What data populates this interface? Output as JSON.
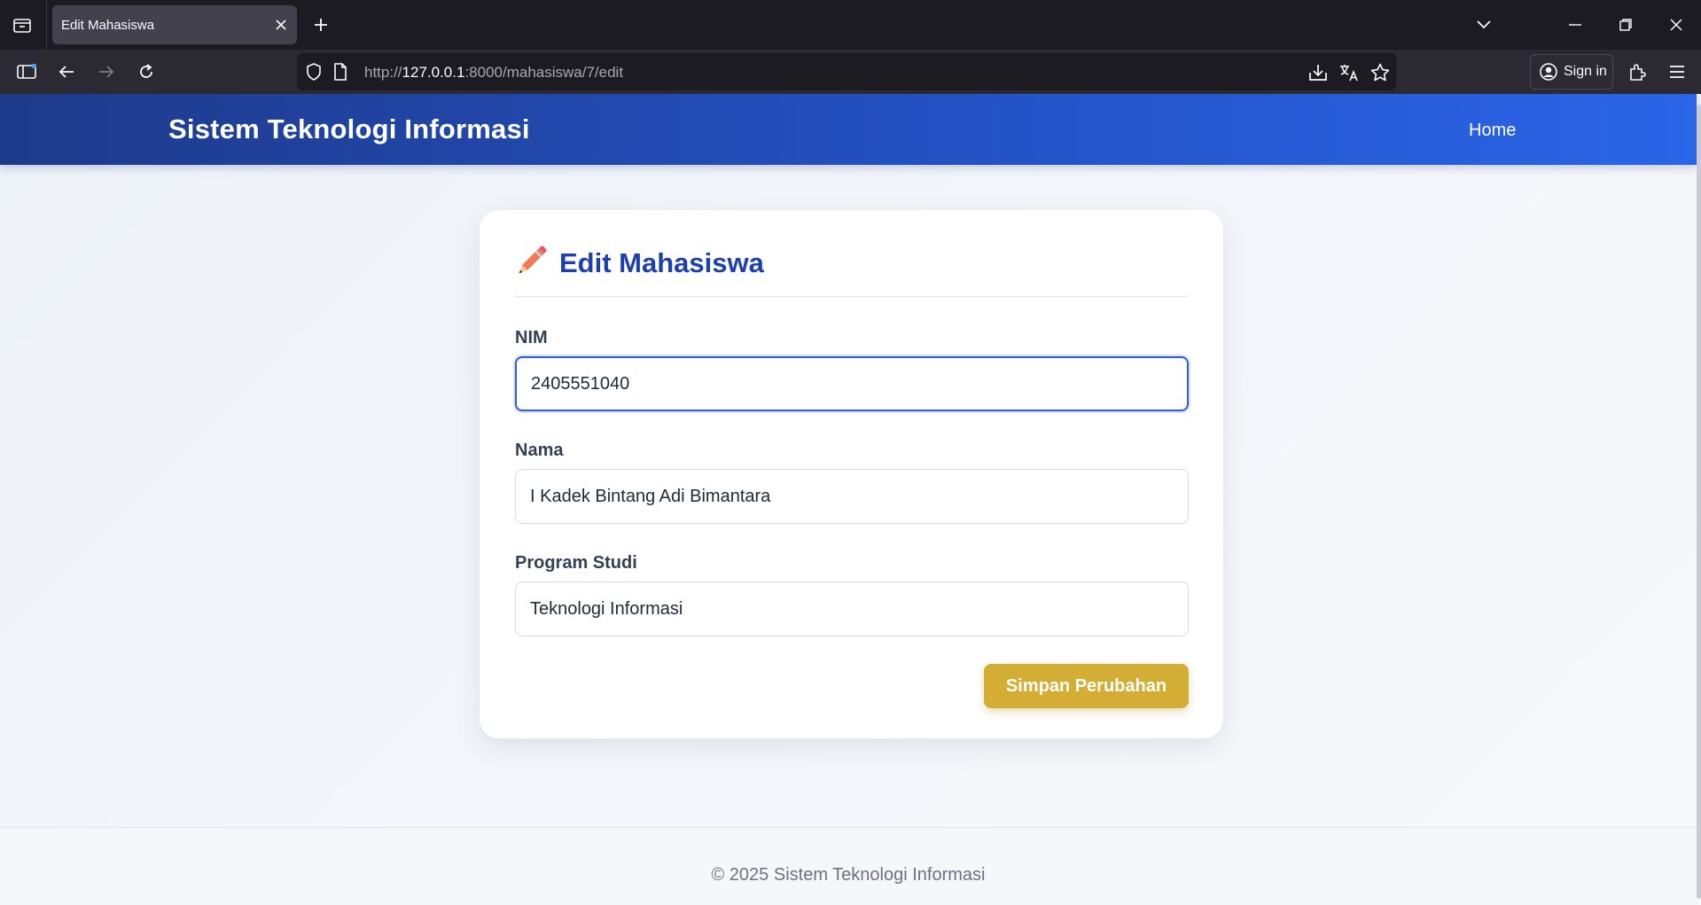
{
  "browser": {
    "tab": {
      "title": "Edit Mahasiswa"
    },
    "url": {
      "prefix": "http://",
      "host": "127.0.0.1",
      "rest": ":8000/mahasiswa/7/edit"
    },
    "signin_label": "Sign in"
  },
  "header": {
    "site_title": "Sistem Teknologi Informasi",
    "nav_home": "Home"
  },
  "form": {
    "title": "Edit Mahasiswa",
    "title_icon": "pencil-icon",
    "fields": [
      {
        "label": "NIM",
        "value": "2405551040"
      },
      {
        "label": "Nama",
        "value": "I Kadek Bintang Adi Bimantara"
      },
      {
        "label": "Program Studi",
        "value": "Teknologi Informasi"
      }
    ],
    "submit_label": "Simpan Perubahan"
  },
  "footer": {
    "text": "© 2025 Sistem Teknologi Informasi"
  },
  "colors": {
    "header_start": "#1e3a8a",
    "header_end": "#2b65e8",
    "title": "#1e40af",
    "button": "#d4ad34",
    "focus_border": "#2f5fd8"
  }
}
